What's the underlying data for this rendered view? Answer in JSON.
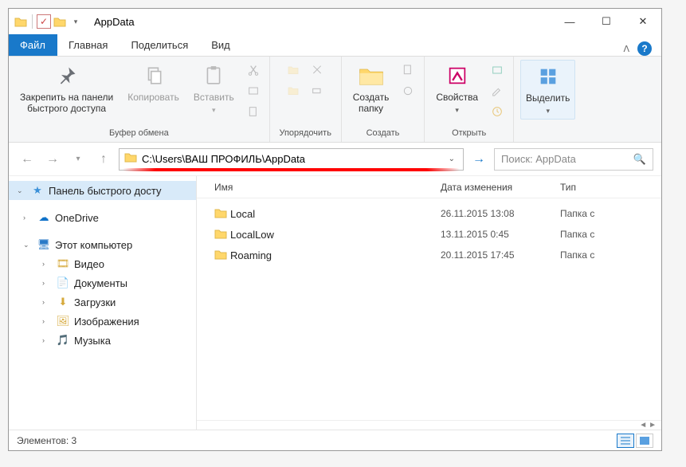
{
  "title": "AppData",
  "menu_tab": "Файл",
  "tabs": [
    "Главная",
    "Поделиться",
    "Вид"
  ],
  "ribbon": {
    "groups": [
      {
        "label": "Буфер обмена",
        "pin": "Закрепить на панели\nбыстрого доступа",
        "copy": "Копировать",
        "paste": "Вставить"
      },
      {
        "label": "Упорядочить"
      },
      {
        "label": "Создать",
        "new_folder": "Создать\nпапку"
      },
      {
        "label": "Открыть",
        "properties": "Свойства"
      },
      {
        "label": "",
        "select": "Выделить"
      }
    ]
  },
  "address": "C:\\Users\\ВАШ ПРОФИЛЬ\\AppData",
  "search_placeholder": "Поиск: AppData",
  "nav": {
    "quick": "Панель быстрого досту",
    "onedrive": "OneDrive",
    "thispc": "Этот компьютер",
    "items": [
      "Видео",
      "Документы",
      "Загрузки",
      "Изображения",
      "Музыка"
    ]
  },
  "columns": {
    "name": "Имя",
    "date": "Дата изменения",
    "type": "Тип"
  },
  "files": [
    {
      "name": "Local",
      "date": "26.11.2015 13:08",
      "type": "Папка с"
    },
    {
      "name": "LocalLow",
      "date": "13.11.2015 0:45",
      "type": "Папка с"
    },
    {
      "name": "Roaming",
      "date": "20.11.2015 17:45",
      "type": "Папка с"
    }
  ],
  "status": "Элементов: 3"
}
